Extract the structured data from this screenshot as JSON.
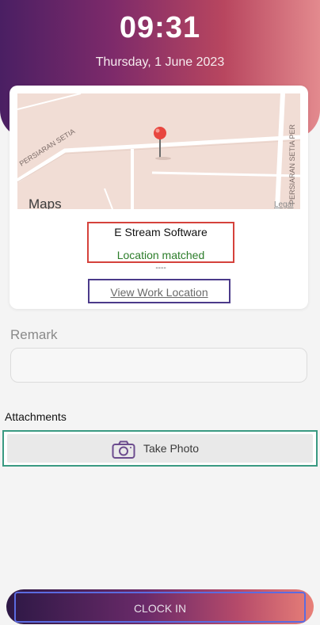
{
  "header": {
    "time": "09:31",
    "date": "Thursday, 1 June 2023"
  },
  "map": {
    "street_label_1": "PERSIARAN SETIA",
    "street_label_2": "PERSIARAN SETIA PER",
    "maps_brand": "Maps",
    "legal_label": "Legal"
  },
  "location": {
    "company_name": "E Stream Software",
    "status": "Location matched",
    "dashes": "----",
    "view_link": "View Work Location"
  },
  "remark": {
    "label": "Remark",
    "value": ""
  },
  "attachments": {
    "label": "Attachments",
    "take_photo_label": "Take Photo",
    "icon": "camera-icon"
  },
  "actions": {
    "clock_in_label": "CLOCK IN"
  },
  "colors": {
    "accent_purple": "#4a1f63",
    "accent_pink": "#e38a8e",
    "status_green": "#2c7d2a",
    "pin_red": "#e8463f"
  }
}
